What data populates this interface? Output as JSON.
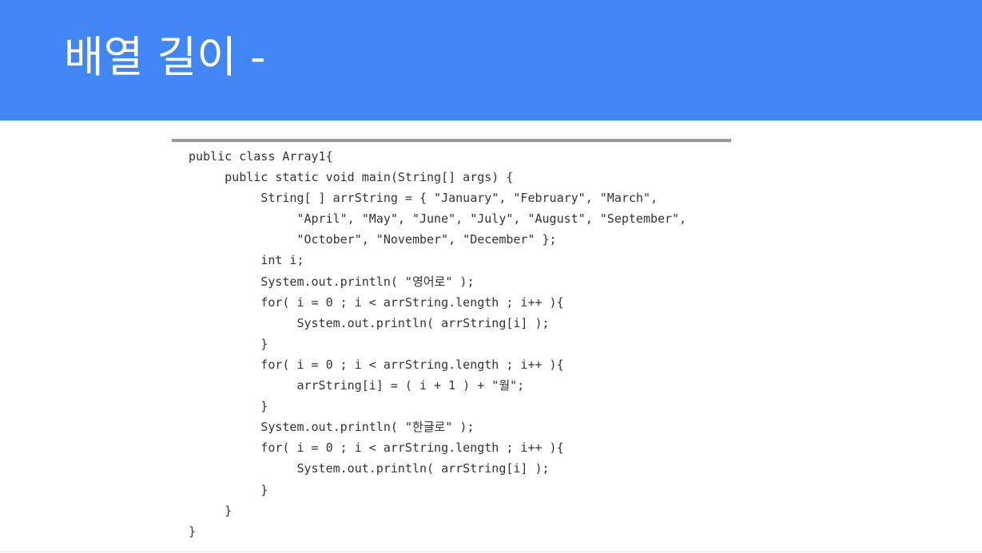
{
  "slide": {
    "title": "배열 길이 -",
    "header_color": "#4285f4"
  },
  "code": {
    "lines": [
      "public class Array1{",
      "     public static void main(String[] args) {",
      "          String[ ] arrString = { \"January\", \"February\", \"March\",",
      "               \"April\", \"May\", \"June\", \"July\", \"August\", \"September\",",
      "               \"October\", \"November\", \"December\" };",
      "          int i;",
      "          System.out.println( \"영어로\" );",
      "          for( i = 0 ; i < arrString.length ; i++ ){",
      "               System.out.println( arrString[i] );",
      "          }",
      "          for( i = 0 ; i < arrString.length ; i++ ){",
      "               arrString[i] = ( i + 1 ) + \"월\";",
      "          }",
      "          System.out.println( \"한글로\" );",
      "          for( i = 0 ; i < arrString.length ; i++ ){",
      "               System.out.println( arrString[i] );",
      "          }",
      "     }",
      "}"
    ]
  }
}
